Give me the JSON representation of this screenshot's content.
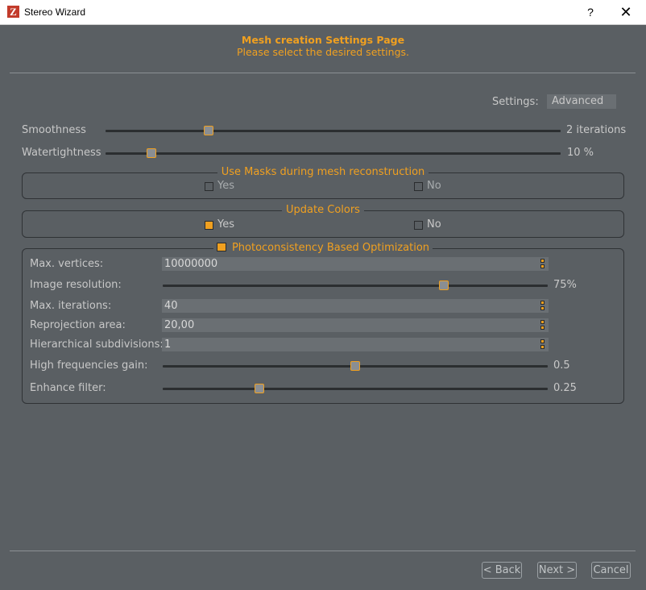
{
  "window": {
    "title": "Stereo Wizard",
    "app_icon": "Z",
    "help_label": "?",
    "close_label": "✕"
  },
  "header": {
    "title": "Mesh creation Settings Page",
    "subtitle": "Please select the desired settings."
  },
  "settings": {
    "label": "Settings:",
    "value": "Advanced"
  },
  "smoothness": {
    "label": "Smoothness",
    "value_text": "2 iterations",
    "fraction": 0.226
  },
  "watertightness": {
    "label": "Watertightness",
    "value_text": "10 %",
    "fraction": 0.1
  },
  "masks_group": {
    "title": "Use Masks during mesh reconstruction",
    "yes": "Yes",
    "no": "No",
    "yes_checked": false,
    "no_checked": false
  },
  "colors_group": {
    "title": "Update Colors",
    "yes": "Yes",
    "no": "No",
    "yes_checked": true,
    "no_checked": false
  },
  "photo_group": {
    "title": "Photoconsistency Based Optimization",
    "enabled": true,
    "max_vertices": {
      "label": "Max. vertices:",
      "value": "10000000"
    },
    "image_resolution": {
      "label": "Image resolution:",
      "value_text": "75%",
      "fraction": 0.73
    },
    "max_iterations": {
      "label": "Max. iterations:",
      "value": "40"
    },
    "reprojection_area": {
      "label": "Reprojection area:",
      "value": "20,00"
    },
    "hierarchical_subdivisions": {
      "label": "Hierarchical subdivisions:",
      "value": "1"
    },
    "high_freq_gain": {
      "label": "High frequencies gain:",
      "value_text": "0.5",
      "fraction": 0.5
    },
    "enhance_filter": {
      "label": "Enhance filter:",
      "value_text": "0.25",
      "fraction": 0.25
    }
  },
  "footer": {
    "back": "< Back",
    "next": "Next >",
    "cancel": "Cancel"
  },
  "colors": {
    "accent": "#f0a020",
    "background": "#5a5f63",
    "field": "#6a6f73"
  }
}
